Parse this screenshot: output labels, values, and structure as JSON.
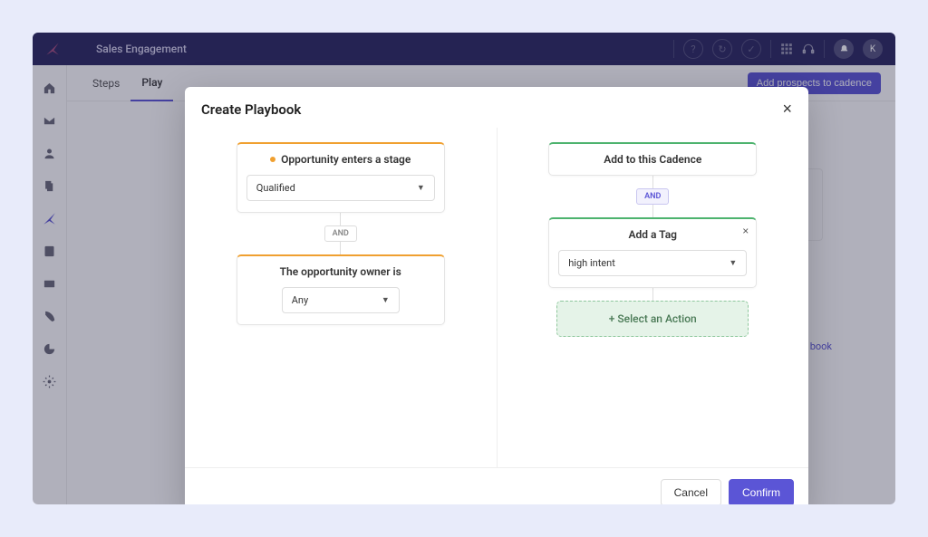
{
  "app": {
    "title": "Sales Engagement",
    "user_initial": "K"
  },
  "tabs": {
    "steps": "Steps",
    "playbooks": "Play"
  },
  "buttons": {
    "add_prospects": "Add prospects to cadence"
  },
  "bg": {
    "link": "book"
  },
  "modal": {
    "title": "Create Playbook",
    "close": "×",
    "footer": {
      "cancel": "Cancel",
      "confirm": "Confirm"
    },
    "left": {
      "trigger": {
        "title": "Opportunity enters a stage",
        "value": "Qualified"
      },
      "and": "AND",
      "owner": {
        "title": "The opportunity owner is",
        "value": "Any"
      }
    },
    "right": {
      "cadence": {
        "title": "Add to this Cadence"
      },
      "and": "AND",
      "tag": {
        "title": "Add a Tag",
        "remove": "×",
        "value": "high intent"
      },
      "select_action": "+ Select an Action"
    }
  }
}
